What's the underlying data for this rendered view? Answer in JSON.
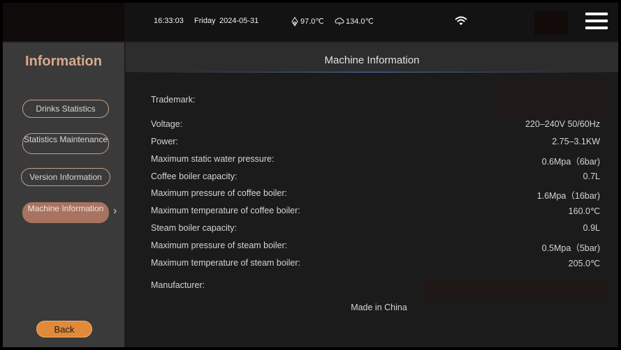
{
  "status_bar": {
    "time": "16:33:03",
    "day": "Friday",
    "date": "2024-05-31",
    "coffee_temp": "97.0℃",
    "steam_temp": "134.0℃",
    "coffee_icon": "coffee-boiler-icon",
    "steam_icon": "steam-boiler-icon",
    "wifi_icon": "wifi-icon",
    "menu_icon": "hamburger-menu-icon"
  },
  "sidebar": {
    "title": "Information",
    "items": [
      {
        "label": "Drinks Statistics"
      },
      {
        "label": "Statistics Maintenance"
      },
      {
        "label": "Version Information"
      },
      {
        "label": "Machine Information",
        "active": true
      }
    ],
    "back_label": "Back"
  },
  "main": {
    "title": "Machine Information",
    "rows": [
      {
        "label": "Trademark:",
        "value": ""
      },
      {
        "label": "Voltage:",
        "value": "220–240V 50/60Hz"
      },
      {
        "label": "Power:",
        "value": "2.75–3.1KW"
      },
      {
        "label": "Maximum static water pressure:",
        "value": "0.6Mpa（6bar)"
      },
      {
        "label": "Coffee boiler capacity:",
        "value": "0.7L"
      },
      {
        "label": "Maximum pressure of coffee boiler:",
        "value": "1.6Mpa（16bar)"
      },
      {
        "label": "Maximum temperature of coffee boiler:",
        "value": "160.0℃"
      },
      {
        "label": "Steam boiler capacity:",
        "value": "0.9L"
      },
      {
        "label": "Maximum pressure of steam boiler:",
        "value": "0.5Mpa（5bar)"
      },
      {
        "label": "Maximum temperature of steam boiler:",
        "value": "205.0℃"
      },
      {
        "label": "Manufacturer:",
        "value": ""
      }
    ],
    "footer": "Made in China"
  },
  "colors": {
    "accent": "#d8a88e",
    "active_button": "#a87360",
    "back_button": "#e08a3a"
  }
}
